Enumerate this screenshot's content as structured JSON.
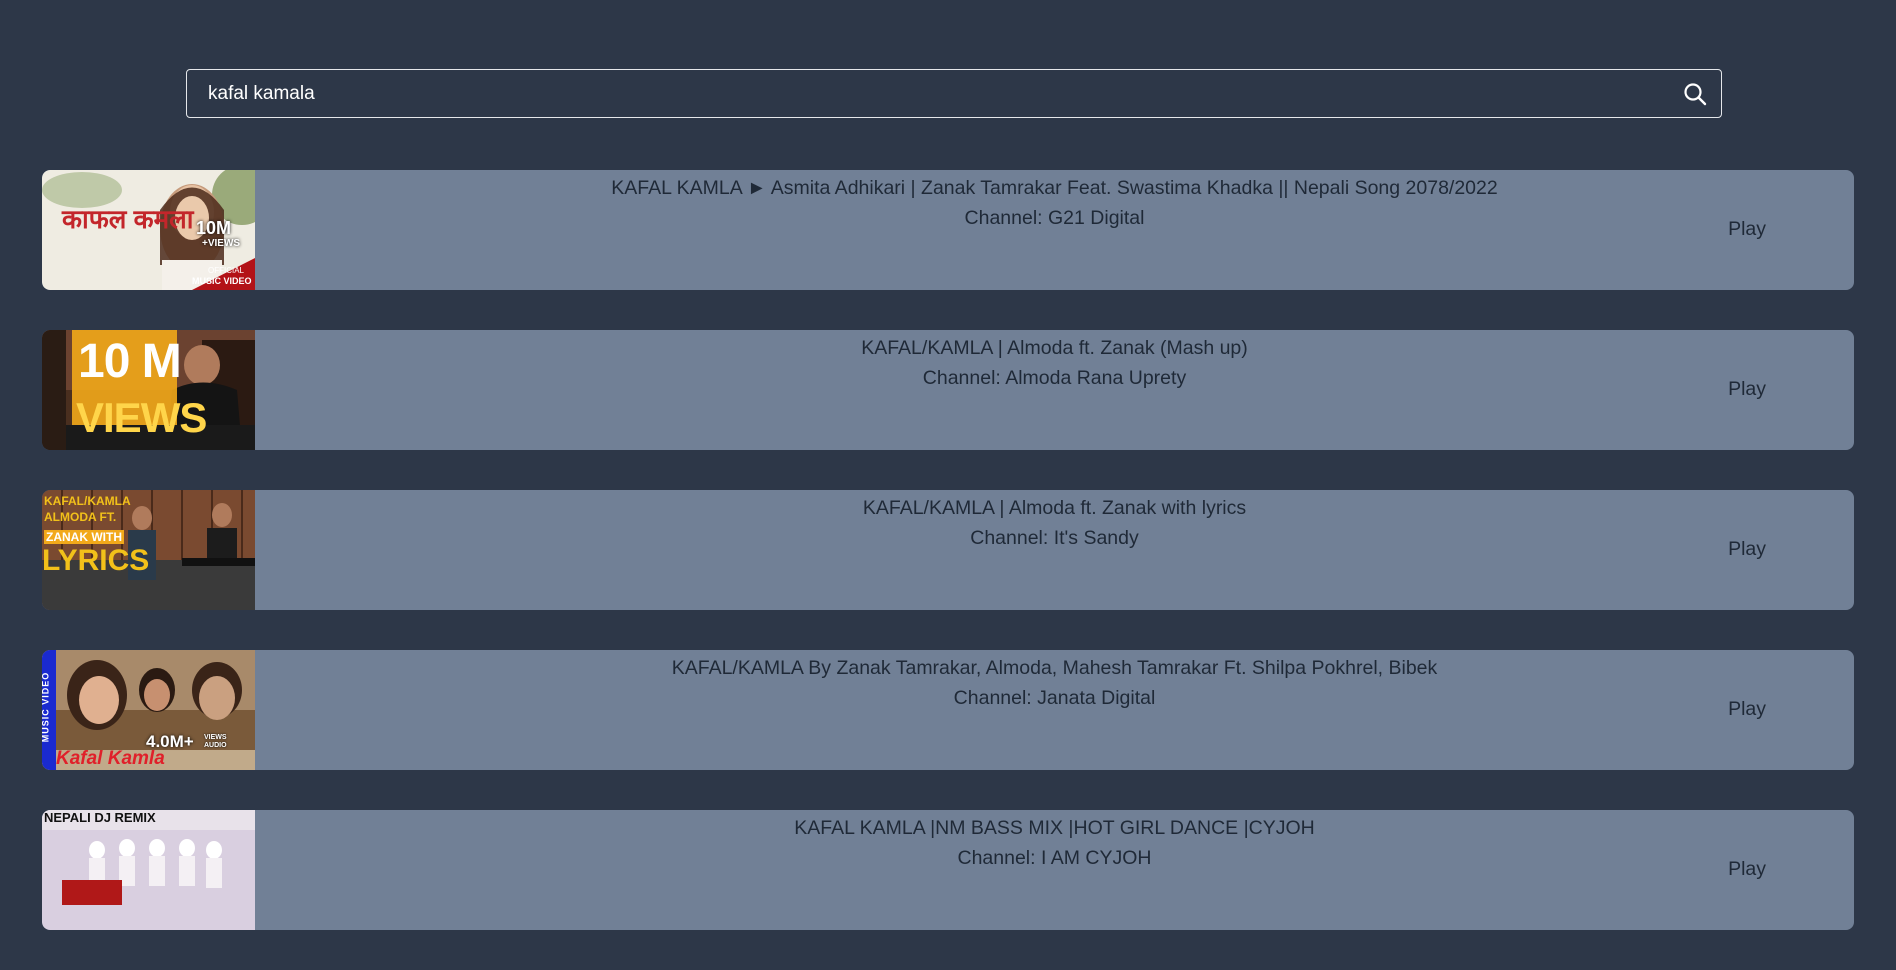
{
  "search": {
    "value": "kafal kamala",
    "placeholder": "Search"
  },
  "results": [
    {
      "title": "KAFAL KAMLA ► Asmita Adhikari | Zanak Tamrakar Feat. Swastima Khadka || Nepali Song 2078/2022",
      "channel_prefix": "Channel: ",
      "channel": "G21 Digital",
      "play": "Play",
      "thumb": {
        "big": "10M",
        "small": "+VIEWS",
        "script": "काफल कमला",
        "tag1": "OFFICIAL",
        "tag2": "MUSIC VIDEO"
      }
    },
    {
      "title": "KAFAL/KAMLA | Almoda ft. Zanak (Mash up)",
      "channel_prefix": "Channel: ",
      "channel": "Almoda Rana Uprety",
      "play": "Play",
      "thumb": {
        "line1": "10 M",
        "line2": "VIEWS"
      }
    },
    {
      "title": "KAFAL/KAMLA | Almoda ft. Zanak with lyrics",
      "channel_prefix": "Channel: ",
      "channel": "It's Sandy",
      "play": "Play",
      "thumb": {
        "line1": "KAFAL/KAMLA",
        "line2": "ALMODA FT.",
        "line3": "ZANAK WITH",
        "line4": "LYRICS"
      }
    },
    {
      "title": "KAFAL/KAMLA By Zanak Tamrakar, Almoda, Mahesh Tamrakar Ft. Shilpa Pokhrel, Bibek",
      "channel_prefix": "Channel: ",
      "channel": "Janata Digital",
      "play": "Play",
      "thumb": {
        "side": "MUSIC VIDEO",
        "views": "4.0M+",
        "views_small": "VIEWS AUDIO",
        "name": "Kafal Kamla"
      }
    },
    {
      "title": "KAFAL KAMLA |NM BASS MIX |HOT GIRL DANCE |CYJOH",
      "channel_prefix": "Channel: ",
      "channel": "I AM CYJOH",
      "play": "Play",
      "thumb": {
        "line1": "NEPALI DJ REMIX"
      }
    }
  ],
  "icons": {
    "search": "search-icon"
  },
  "colors": {
    "background": "#2d3748",
    "card": "#718096",
    "text": "#1f2937"
  }
}
